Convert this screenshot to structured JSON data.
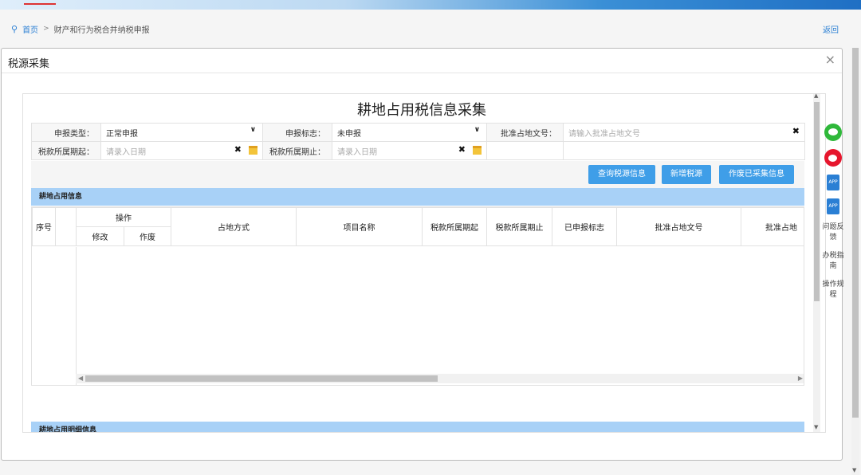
{
  "breadcrumb": {
    "home": "首页",
    "separator": ">",
    "current": "财产和行为税合并纳税申报"
  },
  "back_label": "返回",
  "dialog": {
    "title": "税源采集",
    "close": "×"
  },
  "form": {
    "title": "耕地占用税信息采集",
    "fields": {
      "declare_type_label": "申报类型：",
      "declare_type_value": "正常申报",
      "declare_flag_label": "申报标志：",
      "declare_flag_value": "未申报",
      "approval_no_label": "批准占地文号：",
      "approval_no_placeholder": "请输入批准占地文号",
      "period_start_label": "税款所属期起：",
      "period_start_placeholder": "请录入日期",
      "period_end_label": "税款所属期止：",
      "period_end_placeholder": "请录入日期"
    },
    "buttons": {
      "query": "查询税源信息",
      "add": "新增税源",
      "void": "作废已采集信息"
    }
  },
  "section1": {
    "title": "耕地占用信息"
  },
  "grid": {
    "headers": {
      "seq": "序号",
      "ops": "操作",
      "edit": "修改",
      "void": "作废",
      "method": "占地方式",
      "project": "项目名称",
      "period_start": "税款所属期起",
      "period_end": "税款所属期止",
      "declared_flag": "已申报标志",
      "approval_no": "批准占地文号",
      "approval_cut": "批准占地"
    }
  },
  "section2": {
    "title": "耕地占用明细信息"
  },
  "sidebar": {
    "feedback": "问题反馈",
    "guide": "办税指南",
    "procedure": "操作规程",
    "app1": "APP",
    "app2": "APP"
  },
  "colors": {
    "accent": "#3f9ee8",
    "section_bar": "#a8d1f7",
    "link": "#2a7fd4"
  }
}
